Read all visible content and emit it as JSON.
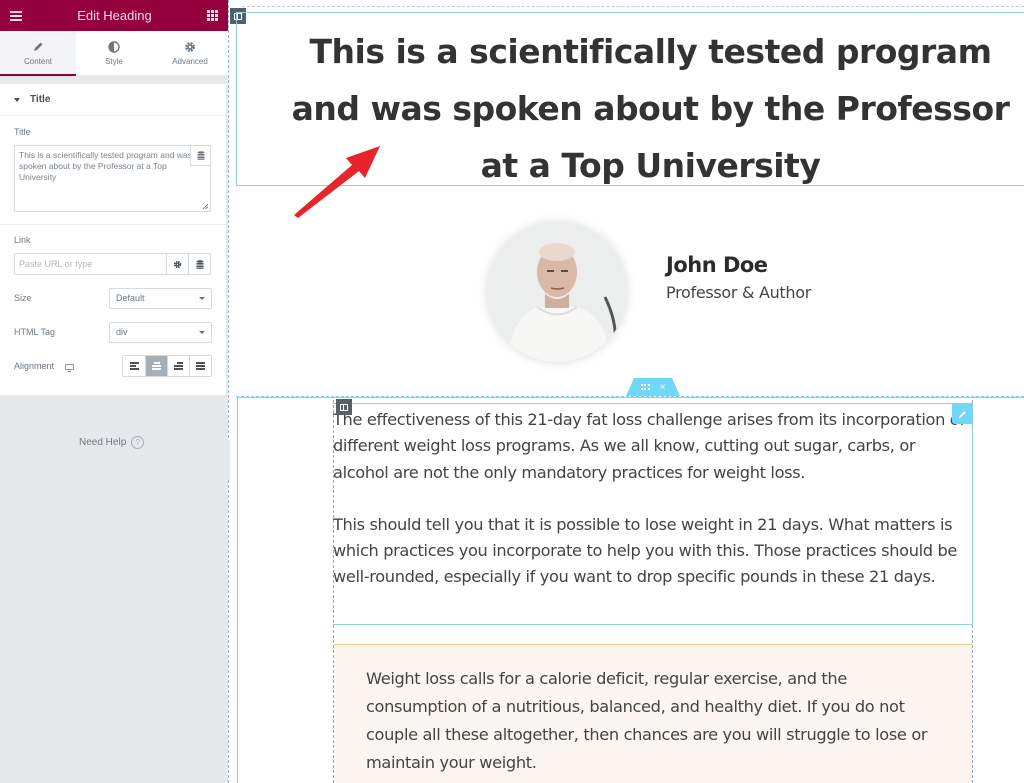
{
  "sidebar": {
    "header_title": "Edit Heading",
    "tabs": [
      {
        "label": "Content",
        "icon": "pencil-icon",
        "active": true
      },
      {
        "label": "Style",
        "icon": "half-circle-icon",
        "active": false
      },
      {
        "label": "Advanced",
        "icon": "gear-icon",
        "active": false
      }
    ],
    "section_title": "Title",
    "title_label": "Title",
    "title_value": "This is a scientifically tested program and was spoken about by the Professor at a Top University",
    "link_label": "Link",
    "link_placeholder": "Paste URL or type",
    "size_label": "Size",
    "size_value": "Default",
    "html_tag_label": "HTML Tag",
    "html_tag_value": "div",
    "alignment_label": "Alignment",
    "alignment_options": [
      "left",
      "center",
      "right",
      "justify"
    ],
    "alignment_selected": "center",
    "need_help": "Need Help",
    "help_glyph": "?",
    "collapse_glyph": "‹"
  },
  "canvas": {
    "heading": "This is a scientifically tested program and was spoken about by the Professor at a Top University",
    "author": {
      "name": "John Doe",
      "role": "Professor & Author"
    },
    "section_handle_close": "×",
    "paragraphs": [
      "The effectiveness of this 21-day fat loss challenge arises from its incorporation of different weight loss programs. As we all know, cutting out sugar, carbs, or alcohol are not the only mandatory practices for weight loss.",
      "This should tell you that it is possible to lose weight in 21 days. What matters is which practices you incorporate to help you with this. Those practices should be well-rounded, especially if you want to drop specific pounds in these 21 days."
    ],
    "note": "Weight loss calls for a calorie deficit, regular exercise, and the consumption of a nutritious, balanced, and healthy diet. If you do not couple all these altogether, then chances are you will struggle to lose or maintain your weight."
  },
  "colors": {
    "brand": "#93003c",
    "accent": "#71d7f7",
    "annotation_arrow": "#e8232a",
    "note_bg": "#fdf6f0"
  }
}
